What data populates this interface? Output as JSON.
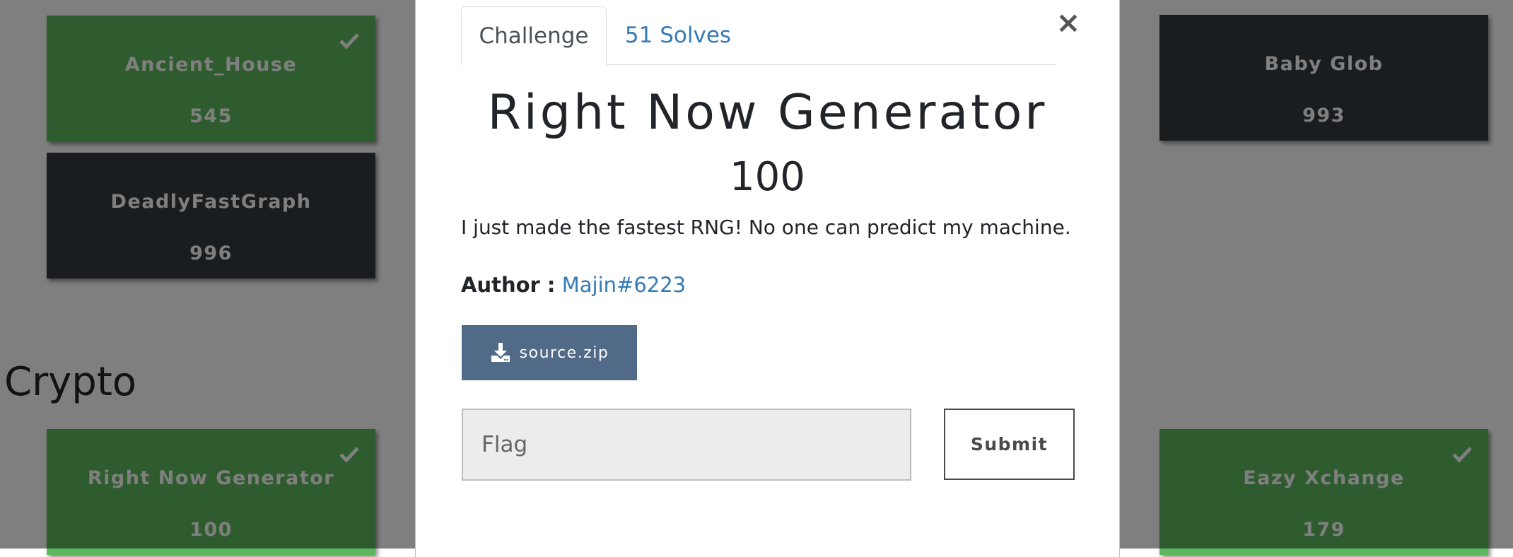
{
  "board": {
    "cards": [
      {
        "name": "Ancient_House",
        "value": "545",
        "solved": true
      },
      {
        "name": "DeadlyFastGraph",
        "value": "996",
        "solved": false
      },
      {
        "name": "Baby Glob",
        "value": "993",
        "solved": false
      },
      {
        "name": "Right Now Generator",
        "value": "100",
        "solved": true
      },
      {
        "name": "Eazy Xchange",
        "value": "179",
        "solved": true
      }
    ],
    "category_heading": "Crypto"
  },
  "modal": {
    "close_symbol": "×",
    "tabs": [
      {
        "label": "Challenge",
        "active": true
      },
      {
        "label": "51 Solves",
        "active": false
      }
    ],
    "title": "Right Now Generator",
    "value": "100",
    "description": "I just made the fastest RNG! No one can predict my machine.",
    "author_label": "Author :",
    "author_name": "Majin#6223",
    "file_button": {
      "icon": "download-icon",
      "label": "source.zip"
    },
    "flag_input": {
      "placeholder": "Flag",
      "value": ""
    },
    "submit_label": "Submit"
  },
  "colors": {
    "solved_card": "#5cb85c",
    "unsolved_card": "#343a40",
    "link": "#337ab7",
    "file_button": "#506a88"
  }
}
